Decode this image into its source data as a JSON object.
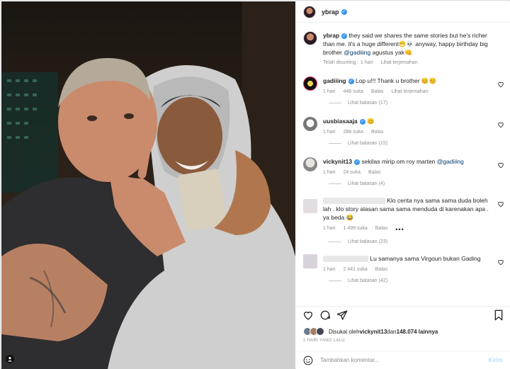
{
  "post": {
    "username": "ybrap",
    "caption_user": "ybrap",
    "caption": "they said we shares the same stories but he's richer than me. it's a huge different😁💀 anyway, happy birthday big brother ",
    "caption_mention": "@gadiiing",
    "caption_tail": " agustus yak👊",
    "caption_meta": {
      "edited": "Telah disunting · 1 hari",
      "translate": "Lihat terjemahan"
    }
  },
  "comments": [
    {
      "user": "gadiiing",
      "verified": true,
      "text": "Lop u!!! Thank u brother 😊😊",
      "time": "1 hari",
      "likes": "448 suka",
      "reply": "Balas",
      "translate": "Lihat terjemahan",
      "replies": "Lihat balasan (17)"
    },
    {
      "user": "uusbiasaaja",
      "verified": true,
      "text": "😊",
      "time": "1 hari",
      "likes": "288 suka",
      "reply": "Balas",
      "replies": "Lihat balasan (15)"
    },
    {
      "user": "vickynit13",
      "verified": true,
      "text": "sekilas mirip om roy marten ",
      "mention": "@gadiiing",
      "time": "1 hari",
      "likes": "24 suka",
      "reply": "Balas",
      "replies": "Lihat balasan (4)"
    },
    {
      "user": "",
      "text": "Klo cerita nya sama sama duda boleh lah . klo story alasan sama sama menduda di karenakan apa . ya beda 😂",
      "time": "1 hari",
      "likes": "1.499 suka",
      "reply": "Balas",
      "more": "•••",
      "replies": "Lihat balasan (23)"
    },
    {
      "user": "",
      "text": "Lu samanya sama Virgoun bukan Gading",
      "time": "1 hari",
      "likes": "2.441 suka",
      "reply": "Balas",
      "replies": "Lihat balasan (42)"
    }
  ],
  "likes_line": {
    "prefix": "Disukai oleh ",
    "user": "vickynit13",
    "mid": " dan ",
    "count": "148.074 lainnya"
  },
  "date": "1 HARI YANG LALU",
  "add_comment": {
    "placeholder": "Tambahkan komentar...",
    "send": "Kirim"
  },
  "colors": {
    "link": "#00376b",
    "verified": "#3897f0",
    "muted": "#8e8e8e"
  }
}
